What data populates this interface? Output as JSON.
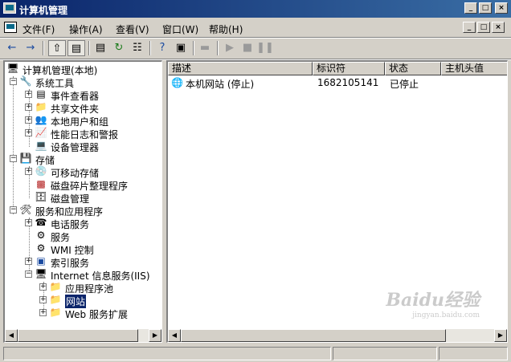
{
  "window": {
    "title": "计算机管理",
    "controls": [
      "_",
      "□",
      "×"
    ]
  },
  "menu": {
    "items": [
      "文件(F)",
      "操作(A)",
      "查看(V)",
      "窗口(W)",
      "帮助(H)"
    ],
    "mdi_controls": [
      "_",
      "□",
      "×"
    ]
  },
  "toolbar": {
    "icons": [
      "back-arrow-icon",
      "forward-arrow-icon",
      "up-folder-icon",
      "show-hide-tree-icon",
      "properties-icon",
      "refresh-icon",
      "export-list-icon",
      "help-icon",
      "console-icon",
      "computer-icon",
      "play-icon",
      "stop-icon",
      "pause-icon"
    ]
  },
  "tree": {
    "items": [
      {
        "label": "计算机管理(本地)",
        "icon": "computer-management-icon",
        "expander": ""
      },
      {
        "label": "系统工具",
        "icon": "system-tools-icon",
        "expander": "−"
      },
      {
        "label": "事件查看器",
        "icon": "event-viewer-icon",
        "expander": "+"
      },
      {
        "label": "共享文件夹",
        "icon": "shared-folder-icon",
        "expander": "+"
      },
      {
        "label": "本地用户和组",
        "icon": "users-icon",
        "expander": "+"
      },
      {
        "label": "性能日志和警报",
        "icon": "performance-icon",
        "expander": "+"
      },
      {
        "label": "设备管理器",
        "icon": "device-manager-icon",
        "expander": ""
      },
      {
        "label": "存储",
        "icon": "storage-icon",
        "expander": "−"
      },
      {
        "label": "可移动存储",
        "icon": "removable-storage-icon",
        "expander": "+"
      },
      {
        "label": "磁盘碎片整理程序",
        "icon": "defrag-icon",
        "expander": ""
      },
      {
        "label": "磁盘管理",
        "icon": "disk-management-icon",
        "expander": ""
      },
      {
        "label": "服务和应用程序",
        "icon": "services-apps-icon",
        "expander": "−"
      },
      {
        "label": "电话服务",
        "icon": "telephony-icon",
        "expander": "+"
      },
      {
        "label": "服务",
        "icon": "services-icon",
        "expander": ""
      },
      {
        "label": "WMI 控制",
        "icon": "wmi-icon",
        "expander": ""
      },
      {
        "label": "索引服务",
        "icon": "indexing-icon",
        "expander": "+"
      },
      {
        "label": "Internet 信息服务(IIS)",
        "icon": "iis-icon",
        "expander": "−"
      },
      {
        "label": "应用程序池",
        "icon": "folder-icon",
        "expander": "+"
      },
      {
        "label": "网站",
        "icon": "websites-icon",
        "expander": "+"
      },
      {
        "label": "Web 服务扩展",
        "icon": "folder-icon",
        "expander": "+"
      }
    ]
  },
  "list": {
    "columns": [
      "描述",
      "标识符",
      "状态",
      "主机头值"
    ],
    "rows": [
      {
        "description": "本机网站 (停止)",
        "identifier": "1682105141",
        "status": "已停止",
        "host_header": ""
      }
    ]
  },
  "watermark": {
    "text": "Baidu经验",
    "sub": "jingyan.baidu.com"
  }
}
